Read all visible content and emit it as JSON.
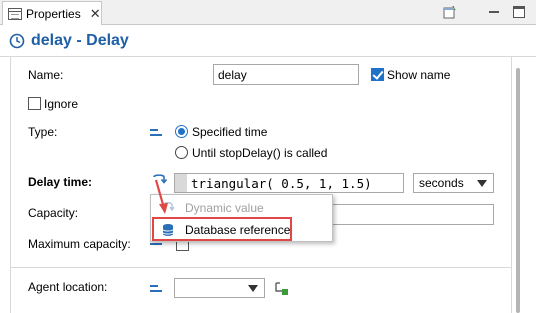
{
  "tab": {
    "label": "Properties",
    "close_glyph": "✕"
  },
  "toolbar": {
    "icons": [
      "new-view-icon",
      "minimize-icon",
      "maximize-icon"
    ]
  },
  "header": {
    "title": "delay - Delay",
    "icon": "clock-icon",
    "title_color": "#1f5fa8"
  },
  "form": {
    "name": {
      "label": "Name:",
      "value": "delay"
    },
    "show_name": {
      "label": "Show name",
      "checked": true
    },
    "ignore": {
      "label": "Ignore",
      "checked": false
    },
    "type": {
      "label": "Type:",
      "options": [
        {
          "label": "Specified time",
          "selected": true
        },
        {
          "label": "Until stopDelay() is called",
          "selected": false
        }
      ]
    },
    "delay_time": {
      "label": "Delay time:",
      "expression": "triangular( 0.5, 1, 1.5)",
      "unit": "seconds"
    },
    "capacity": {
      "label": "Capacity:"
    },
    "maximum_capacity": {
      "label": "Maximum capacity:"
    },
    "agent_location": {
      "label": "Agent location:"
    }
  },
  "popup_menu": {
    "items": [
      {
        "label": "Dynamic value",
        "disabled": true
      },
      {
        "label": "Database reference",
        "disabled": false,
        "highlighted": true
      }
    ]
  },
  "colors": {
    "accent": "#1e72c8",
    "highlight_border": "#e04848",
    "link_icon": "#2a6fb8"
  }
}
